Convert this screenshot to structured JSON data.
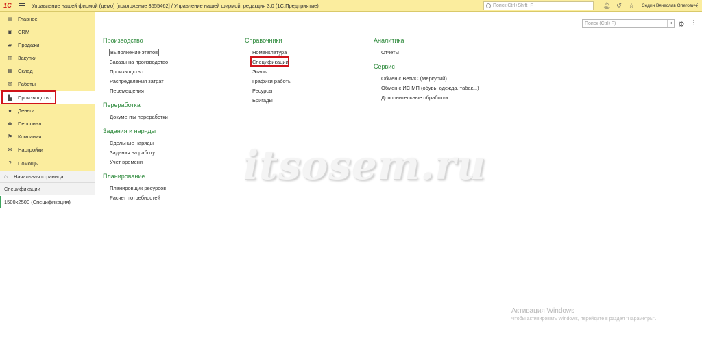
{
  "titlebar": {
    "logo": "1С",
    "title": "Управление нашей фирмой (демо) [приложение 3555462] / Управление нашей фирмой, редакция 3.0  (1С:Предприятие)",
    "search_placeholder": "Поиск Ctrl+Shift+F",
    "user": "Седин Вячеслав Олегович"
  },
  "sidebar": {
    "items": [
      {
        "label": "Главное",
        "icon": "home-list-icon"
      },
      {
        "label": "CRM",
        "icon": "crm-icon"
      },
      {
        "label": "Продажи",
        "icon": "sales-icon"
      },
      {
        "label": "Закупки",
        "icon": "purchases-icon"
      },
      {
        "label": "Склад",
        "icon": "warehouse-icon"
      },
      {
        "label": "Работы",
        "icon": "works-icon"
      },
      {
        "label": "Производство",
        "icon": "production-icon"
      },
      {
        "label": "Деньги",
        "icon": "money-icon"
      },
      {
        "label": "Персонал",
        "icon": "personnel-icon"
      },
      {
        "label": "Компания",
        "icon": "company-icon"
      },
      {
        "label": "Настройки",
        "icon": "settings-icon"
      },
      {
        "label": "Помощь",
        "icon": "help-icon"
      }
    ],
    "active_index": 6,
    "open_windows": {
      "home": "Начальная страница",
      "spec": "Спецификации",
      "doc": "1500x2500 (Спецификация)"
    }
  },
  "main": {
    "search_placeholder": "Поиск (Ctrl+F)",
    "sections": {
      "production": {
        "title": "Производство",
        "links": [
          "Выполнение этапов",
          "Заказы на производство",
          "Производство",
          "Распределения затрат",
          "Перемещения"
        ]
      },
      "processing": {
        "title": "Переработка",
        "links": [
          "Документы переработки"
        ]
      },
      "tasks": {
        "title": "Задания и наряды",
        "links": [
          "Сдельные наряды",
          "Задания на работу",
          "Учет времени"
        ]
      },
      "planning": {
        "title": "Планирование",
        "links": [
          "Планировщик ресурсов",
          "Расчет потребностей"
        ]
      },
      "reference": {
        "title": "Справочники",
        "links": [
          "Номенклатура",
          "Спецификации",
          "Этапы",
          "Графики работы",
          "Ресурсы",
          "Бригады"
        ]
      },
      "analytics": {
        "title": "Аналитика",
        "links": [
          "Отчеты"
        ]
      },
      "service": {
        "title": "Сервис",
        "links": [
          "Обмен с ВетИС (Меркурий)",
          "Обмен с ИС МП (обувь, одежда, табак...)",
          "Дополнительные обработки"
        ]
      }
    },
    "watermark": "itsosem.ru",
    "activation_title": "Активация Windows",
    "activation_text": "Чтобы активировать Windows, перейдите в раздел \"Параметры\"."
  },
  "colors": {
    "accent_yellow": "#fbed9e",
    "section_green": "#2e8a3c",
    "highlight_red": "#d0141b"
  }
}
